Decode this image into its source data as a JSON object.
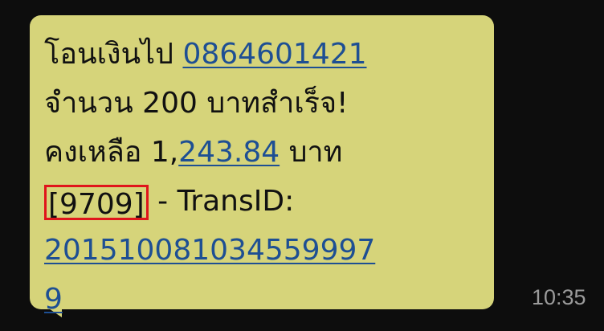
{
  "message": {
    "line1_text": "โอนเงินไป ",
    "phone_link": "0864601421",
    "line2_text": "จำนวน 200 บาทสำเร็จ!",
    "balance_prefix": "คงเหลือ 1,",
    "balance_link": "243.84",
    "balance_suffix": " บาท",
    "code_boxed": "[9709]",
    "transid_label": " - TransID:",
    "transid_line1": "201510081034559997",
    "transid_line2": "9"
  },
  "timestamp": "10:35",
  "colors": {
    "background": "#0d0d0d",
    "bubble": "#d6d47a",
    "link": "#1e4f93",
    "highlight_box": "#e0151b",
    "timestamp": "#9b9b9b"
  }
}
